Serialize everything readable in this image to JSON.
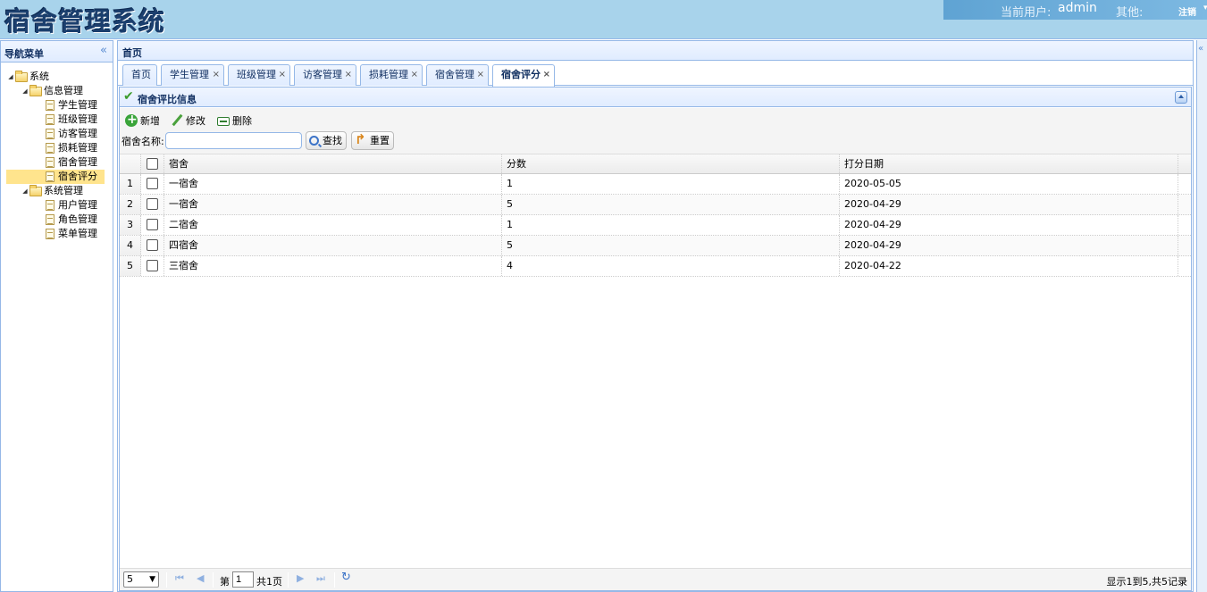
{
  "header": {
    "logo": "宿舍管理系统",
    "current_user_label": "当前用户:",
    "username": "admin",
    "other_label": "其他:",
    "logout": "注销",
    "logout_caret": "▾"
  },
  "west": {
    "title": "导航菜单",
    "collapse": "«",
    "tree": {
      "root": "系统",
      "group1": "信息管理",
      "group1_items": [
        "学生管理",
        "班级管理",
        "访客管理",
        "损耗管理",
        "宿舍管理",
        "宿舍评分"
      ],
      "group2": "系统管理",
      "group2_items": [
        "用户管理",
        "角色管理",
        "菜单管理"
      ],
      "selected": "宿舍评分"
    }
  },
  "center": {
    "title": "首页",
    "tabs": [
      {
        "label": "首页",
        "closable": false
      },
      {
        "label": "学生管理",
        "closable": true
      },
      {
        "label": "班级管理",
        "closable": true
      },
      {
        "label": "访客管理",
        "closable": true
      },
      {
        "label": "损耗管理",
        "closable": true
      },
      {
        "label": "宿舍管理",
        "closable": true
      },
      {
        "label": "宿舍评分",
        "closable": true,
        "active": true
      }
    ],
    "tab_close": "×"
  },
  "panel": {
    "title": "宿舍评比信息",
    "toolbar": {
      "add": "新增",
      "edit": "修改",
      "delete": "删除",
      "search_label": "宿舍名称:",
      "search_value": "",
      "search_btn": "查找",
      "reset_btn": "重置"
    },
    "grid": {
      "columns": [
        "宿舍",
        "分数",
        "打分日期"
      ],
      "rows": [
        {
          "num": "1",
          "dorm": "一宿舍",
          "score": "1",
          "date": "2020-05-05"
        },
        {
          "num": "2",
          "dorm": "一宿舍",
          "score": "5",
          "date": "2020-04-29"
        },
        {
          "num": "3",
          "dorm": "二宿舍",
          "score": "1",
          "date": "2020-04-29"
        },
        {
          "num": "4",
          "dorm": "四宿舍",
          "score": "5",
          "date": "2020-04-29"
        },
        {
          "num": "5",
          "dorm": "三宿舍",
          "score": "4",
          "date": "2020-04-22"
        }
      ]
    },
    "pager": {
      "page_size": "5",
      "page_prefix": "第",
      "page_value": "1",
      "page_suffix": "共1页",
      "info": "显示1到5,共5记录"
    }
  },
  "colors": {
    "header_bg": "#a8d3eb",
    "border": "#95b8e7",
    "selected_node": "#ffe48d"
  }
}
